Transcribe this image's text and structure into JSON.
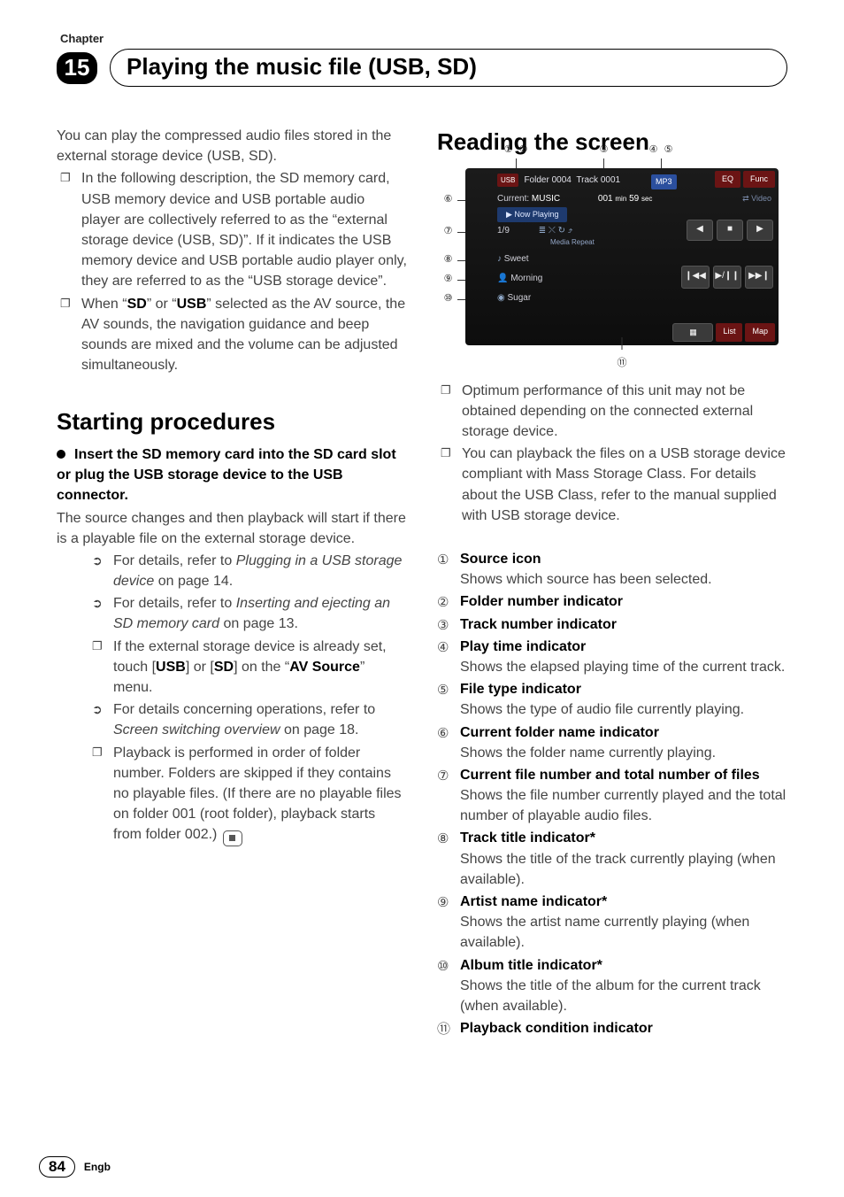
{
  "chapter": {
    "label": "Chapter",
    "num": "15",
    "title": "Playing the music file (USB, SD)"
  },
  "intro": "You can play the compressed audio files stored in the external storage device (USB, SD).",
  "intro_bullets": {
    "b1_a": "In the following description, the SD memory card, USB memory device and USB portable audio player are collectively referred to as the “external storage device (USB, SD)”. If it indicates the USB memory device and USB portable audio player only, they are referred to as the “USB storage device”.",
    "b2_a": "When “",
    "b2_sd": "SD",
    "b2_b": "” or “",
    "b2_usb": "USB",
    "b2_c": "” selected as the AV source, the AV sounds, the navigation guidance and beep sounds are mixed and the volume can be adjusted simultaneously."
  },
  "starting": {
    "heading": "Starting procedures",
    "step_title": "Insert the SD memory card into the SD card slot or plug the USB storage device to the USB connector.",
    "after": "The source changes and then playback will start if there is a playable file on the external storage device.",
    "sub": {
      "s1_a": "For details, refer to ",
      "s1_i": "Plugging in a USB storage device",
      "s1_b": " on page 14.",
      "s2_a": "For details, refer to ",
      "s2_i": "Inserting and ejecting an SD memory card",
      "s2_b": " on page 13.",
      "s3_a": "If the external storage device is already set, touch [",
      "s3_b": "USB",
      "s3_c": "] or [",
      "s3_d": "SD",
      "s3_e": "] on the “",
      "s3_f": "AV Source",
      "s3_g": "” menu.",
      "s4_a": "For details concerning operations, refer to ",
      "s4_i": "Screen switching overview",
      "s4_b": " on page 18.",
      "s5": "Playback is performed in order of folder number. Folders are skipped if they contains no playable files. (If there are no playable files on folder 001 (root folder), playback starts from folder 002.)"
    }
  },
  "reading": {
    "heading": "Reading the screen",
    "notes": {
      "n1": "Optimum performance of this unit may not be obtained depending on the connected external storage device.",
      "n2": "You can playback the files on a USB storage device compliant with Mass Storage Class. For details about the USB Class, refer to the manual supplied with USB storage device."
    },
    "items": {
      "i1_t": "Source icon",
      "i1_d": "Shows which source has been selected.",
      "i2_t": "Folder number indicator",
      "i3_t": "Track number indicator",
      "i4_t": "Play time indicator",
      "i4_d": "Shows the elapsed playing time of the current track.",
      "i5_t": "File type indicator",
      "i5_d": "Shows the type of audio file currently playing.",
      "i6_t": "Current folder name indicator",
      "i6_d": "Shows the folder name currently playing.",
      "i7_t": "Current file number and total number of files",
      "i7_d": "Shows the file number currently played and the total number of playable audio files.",
      "i8_t": "Track title indicator*",
      "i8_d": "Shows the title of the track currently playing (when available).",
      "i9_t": "Artist name indicator*",
      "i9_d": "Shows the artist name currently playing (when available).",
      "i10_t": "Album title indicator*",
      "i10_d": "Shows the title of the album for the current track (when available).",
      "i11_t": "Playback condition indicator"
    }
  },
  "screen": {
    "usb_badge": "USB",
    "folder_label": "Folder",
    "folder_num": "0004",
    "track_label": "Track",
    "track_num": "0001",
    "mp3": "MP3",
    "eq": "EQ",
    "func": "Func",
    "current_label": "Current:",
    "current_val": "MUSIC",
    "time_min": "001",
    "time_min_u": "min",
    "time_sec": "59",
    "time_sec_u": "sec",
    "video": "Video",
    "now_playing": "Now Playing",
    "pos": "1/9",
    "media_repeat": "Media Repeat",
    "row_track": "Sweet",
    "row_artist": "Morning",
    "row_album": "Sugar",
    "list": "List",
    "map": "Map"
  },
  "footer": {
    "page": "84",
    "lang": "Engb"
  }
}
